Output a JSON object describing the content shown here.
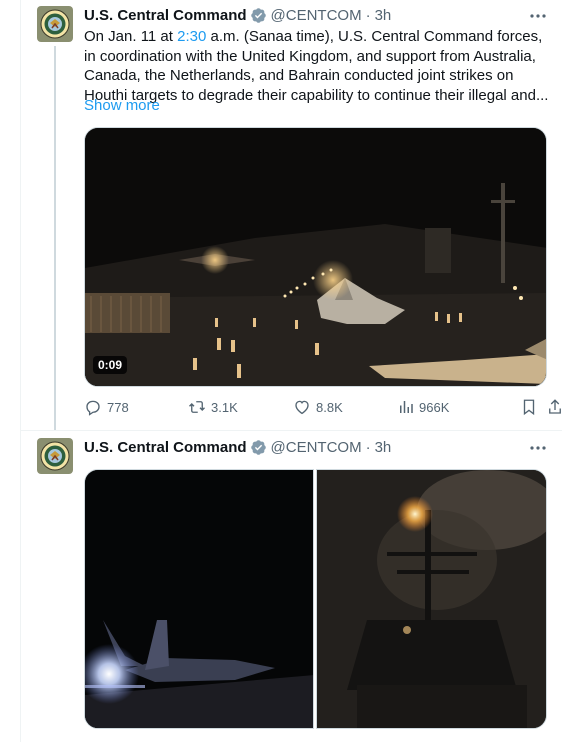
{
  "tweets": [
    {
      "author_name": "U.S. Central Command",
      "handle": "@CENTCOM",
      "separator": "·",
      "time": "3h",
      "text_before_link": "On Jan. 11 at ",
      "text_link": "2:30",
      "text_after_link": " a.m. (Sanaa time), U.S. Central Command forces, in coordination with the United Kingdom, and support from Australia, Canada, the Netherlands, and Bahrain conducted joint strikes on Houthi targets to degrade their capability to continue their illegal and...",
      "show_more": "Show more",
      "video_duration": "0:09",
      "stats": {
        "replies": "778",
        "reposts": "3.1K",
        "likes": "8.8K",
        "views": "966K"
      }
    },
    {
      "author_name": "U.S. Central Command",
      "handle": "@CENTCOM",
      "separator": "·",
      "time": "3h"
    }
  ],
  "colors": {
    "link": "#1d9bf0",
    "verified_badge": "#829aab",
    "secondary_text": "#536471"
  },
  "icons": [
    "centcom-seal-icon",
    "verified-badge-icon",
    "more-options-icon",
    "reply-icon",
    "repost-icon",
    "like-icon",
    "views-icon",
    "bookmark-icon",
    "share-icon"
  ]
}
